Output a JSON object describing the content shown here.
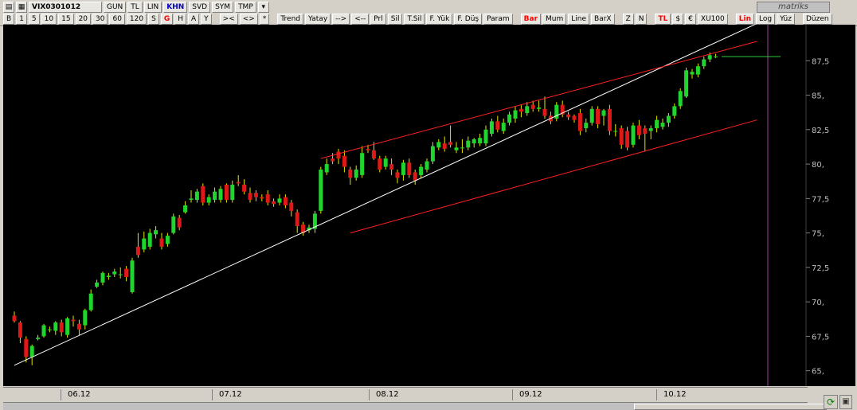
{
  "toolbar": {
    "symbol": "VIX0301012",
    "row1": [
      "GUN",
      "TL",
      "LIN",
      "KHN",
      "SVD",
      "SYM",
      "TMP"
    ],
    "row2_periods": [
      "B",
      "1",
      "5",
      "10",
      "15",
      "20",
      "30",
      "60",
      "120",
      "S",
      "G",
      "H",
      "A",
      "Y"
    ],
    "row2_nav": [
      "><",
      "<>",
      "*"
    ],
    "row2_tools": [
      "Trend",
      "Yatay",
      "-->",
      "<--",
      "Prl",
      "Sil",
      "T.Sil",
      "F. Yük",
      "F. Düş",
      "Param"
    ],
    "row2_types": [
      "Bar",
      "Mum",
      "Line",
      "BarX"
    ],
    "row2_zoom": [
      "Z",
      "N"
    ],
    "row2_units": [
      "TL",
      "$",
      "€",
      "XU100"
    ],
    "row2_scale": [
      "Lin",
      "Log",
      "Yüz"
    ],
    "row2_edit": "Düzen",
    "logo": "matriks"
  },
  "chart_data": {
    "type": "candlestick",
    "ylim": [
      64,
      90
    ],
    "yticks": [
      "65,",
      "67,5",
      "70,",
      "72,5",
      "75,",
      "77,5",
      "80,",
      "82,5",
      "85,",
      "87,5"
    ],
    "xticks": [
      "06.12",
      "07.12",
      "08.12",
      "09.12",
      "10.12"
    ],
    "last_price": 87.8,
    "candles": [
      [
        69.0,
        68.6,
        69.3,
        68.5
      ],
      [
        68.5,
        67.4,
        68.6,
        67.0
      ],
      [
        67.3,
        66.0,
        67.5,
        65.6
      ],
      [
        66.0,
        66.8,
        66.9,
        65.4
      ],
      [
        67.3,
        67.4,
        67.6,
        67.2
      ],
      [
        67.5,
        68.3,
        68.4,
        67.4
      ],
      [
        68.0,
        68.0,
        68.2,
        67.8
      ],
      [
        67.9,
        68.5,
        68.6,
        67.6
      ],
      [
        68.5,
        67.8,
        68.7,
        67.5
      ],
      [
        67.6,
        68.8,
        68.9,
        67.4
      ],
      [
        68.7,
        68.6,
        69.0,
        68.2
      ],
      [
        68.4,
        68.0,
        68.7,
        67.6
      ],
      [
        68.3,
        69.4,
        69.5,
        68.0
      ],
      [
        69.4,
        70.6,
        70.9,
        69.3
      ],
      [
        71.1,
        71.4,
        71.6,
        71.0
      ],
      [
        71.4,
        72.1,
        72.2,
        71.2
      ],
      [
        71.8,
        71.9,
        72.1,
        71.6
      ],
      [
        72.0,
        72.2,
        72.4,
        71.8
      ],
      [
        72.0,
        72.0,
        72.5,
        71.7
      ],
      [
        72.4,
        71.8,
        72.6,
        71.5
      ],
      [
        70.7,
        73.0,
        73.2,
        70.6
      ],
      [
        74.0,
        73.4,
        75.0,
        73.2
      ],
      [
        73.8,
        74.6,
        75.1,
        73.6
      ],
      [
        74.0,
        75.0,
        75.3,
        73.8
      ],
      [
        74.9,
        75.2,
        75.5,
        74.6
      ],
      [
        74.6,
        74.0,
        75.0,
        73.8
      ],
      [
        74.2,
        74.8,
        75.0,
        74.0
      ],
      [
        75.0,
        76.2,
        76.4,
        74.9
      ],
      [
        76.1,
        75.4,
        76.3,
        75.2
      ],
      [
        76.5,
        77.0,
        77.3,
        76.4
      ],
      [
        77.4,
        77.5,
        78.1,
        77.2
      ],
      [
        77.4,
        78.0,
        78.2,
        77.2
      ],
      [
        78.4,
        77.2,
        78.6,
        77.0
      ],
      [
        77.2,
        77.6,
        77.8,
        77.0
      ],
      [
        77.4,
        78.0,
        78.3,
        77.2
      ],
      [
        77.4,
        78.2,
        78.4,
        77.2
      ],
      [
        78.5,
        77.4,
        78.6,
        77.2
      ],
      [
        77.4,
        78.5,
        78.8,
        77.2
      ],
      [
        78.7,
        78.6,
        79.2,
        78.4
      ],
      [
        78.5,
        78.0,
        78.9,
        77.8
      ],
      [
        77.9,
        77.4,
        78.3,
        77.2
      ],
      [
        77.9,
        77.6,
        78.1,
        77.3
      ],
      [
        77.6,
        77.5,
        77.8,
        77.3
      ],
      [
        77.8,
        77.2,
        78.1,
        77.0
      ],
      [
        77.3,
        77.1,
        77.5,
        76.9
      ],
      [
        77.2,
        77.5,
        77.8,
        77.0
      ],
      [
        77.6,
        77.0,
        77.8,
        76.8
      ],
      [
        77.2,
        76.6,
        77.4,
        76.2
      ],
      [
        76.5,
        75.5,
        76.7,
        75.0
      ],
      [
        75.6,
        75.0,
        75.8,
        74.8
      ],
      [
        75.2,
        75.4,
        75.6,
        75.0
      ],
      [
        75.3,
        76.4,
        76.6,
        75.0
      ],
      [
        76.6,
        79.6,
        79.8,
        76.4
      ],
      [
        79.4,
        80.0,
        80.4,
        79.2
      ],
      [
        80.4,
        80.2,
        80.8,
        80.0
      ],
      [
        80.9,
        80.4,
        81.1,
        80.0
      ],
      [
        80.6,
        79.8,
        81.0,
        79.4
      ],
      [
        79.6,
        79.0,
        79.8,
        78.5
      ],
      [
        79.0,
        79.6,
        79.9,
        78.8
      ],
      [
        79.2,
        80.8,
        81.3,
        79.0
      ],
      [
        81.1,
        81.0,
        81.4,
        80.8
      ],
      [
        81.0,
        80.4,
        81.6,
        80.3
      ],
      [
        80.4,
        79.6,
        80.6,
        79.4
      ],
      [
        79.8,
        80.4,
        80.6,
        79.6
      ],
      [
        80.0,
        79.6,
        80.4,
        79.2
      ],
      [
        79.4,
        79.0,
        79.6,
        78.6
      ],
      [
        79.2,
        80.1,
        80.3,
        78.8
      ],
      [
        80.1,
        79.2,
        80.4,
        79.0
      ],
      [
        79.4,
        78.8,
        79.6,
        78.5
      ],
      [
        79.2,
        79.8,
        80.0,
        79.0
      ],
      [
        79.6,
        80.2,
        80.4,
        79.4
      ],
      [
        80.2,
        81.3,
        81.6,
        80.0
      ],
      [
        81.2,
        81.6,
        81.8,
        81.0
      ],
      [
        81.5,
        81.1,
        82.0,
        80.9
      ],
      [
        81.6,
        81.4,
        82.8,
        81.2
      ],
      [
        81.0,
        81.2,
        81.6,
        80.8
      ],
      [
        81.2,
        81.2,
        81.8,
        80.8
      ],
      [
        81.2,
        81.7,
        82.0,
        81.0
      ],
      [
        81.5,
        81.8,
        81.9,
        81.2
      ],
      [
        81.5,
        81.9,
        82.2,
        81.3
      ],
      [
        81.5,
        82.5,
        82.8,
        81.3
      ],
      [
        82.2,
        83.1,
        83.3,
        82.0
      ],
      [
        83.1,
        82.5,
        83.5,
        82.3
      ],
      [
        82.4,
        83.0,
        83.3,
        82.2
      ],
      [
        83.0,
        83.6,
        83.8,
        82.8
      ],
      [
        83.3,
        83.9,
        84.2,
        83.0
      ],
      [
        84.0,
        83.8,
        84.3,
        83.4
      ],
      [
        83.7,
        84.2,
        84.5,
        83.5
      ],
      [
        84.3,
        84.0,
        84.6,
        83.8
      ],
      [
        84.0,
        84.1,
        84.6,
        83.8
      ],
      [
        84.0,
        83.5,
        84.9,
        83.3
      ],
      [
        83.5,
        83.1,
        83.8,
        82.9
      ],
      [
        83.3,
        84.3,
        84.5,
        83.1
      ],
      [
        84.3,
        83.6,
        84.6,
        83.4
      ],
      [
        83.6,
        83.4,
        83.8,
        83.2
      ],
      [
        83.5,
        83.2,
        83.6,
        83.0
      ],
      [
        83.7,
        82.4,
        84.0,
        82.1
      ],
      [
        82.6,
        83.0,
        83.3,
        82.3
      ],
      [
        83.0,
        84.0,
        84.2,
        82.8
      ],
      [
        84.0,
        82.9,
        84.2,
        82.6
      ],
      [
        83.5,
        83.9,
        84.0,
        82.8
      ],
      [
        84.0,
        82.4,
        84.3,
        82.1
      ],
      [
        82.4,
        82.4,
        82.9,
        82.0
      ],
      [
        82.6,
        81.4,
        82.8,
        81.1
      ],
      [
        82.4,
        81.2,
        82.7,
        81.0
      ],
      [
        81.4,
        82.8,
        83.0,
        81.2
      ],
      [
        82.8,
        82.1,
        83.2,
        81.8
      ],
      [
        82.6,
        82.2,
        82.8,
        80.9
      ],
      [
        82.4,
        82.6,
        82.8,
        81.8
      ],
      [
        82.6,
        83.2,
        83.5,
        82.3
      ],
      [
        82.7,
        83.0,
        83.3,
        82.5
      ],
      [
        83.0,
        83.5,
        83.7,
        82.7
      ],
      [
        83.5,
        84.2,
        84.4,
        83.3
      ],
      [
        84.2,
        85.3,
        85.5,
        84.0
      ],
      [
        84.9,
        86.8,
        87.0,
        84.8
      ],
      [
        86.5,
        86.7,
        86.9,
        86.2
      ],
      [
        86.5,
        87.1,
        87.3,
        86.3
      ],
      [
        87.1,
        87.6,
        87.8,
        86.9
      ],
      [
        87.6,
        87.9,
        88.1,
        87.4
      ],
      [
        87.8,
        87.8,
        88.0,
        87.7
      ]
    ],
    "lines": [
      {
        "color": "#ffffff",
        "points": [
          [
            0,
            65.4
          ],
          [
            126,
            90.2
          ]
        ]
      },
      {
        "color": "#ff2020",
        "points": [
          [
            52,
            80.4
          ],
          [
            126,
            88.9
          ]
        ]
      },
      {
        "color": "#ff2020",
        "points": [
          [
            57,
            75.0
          ],
          [
            126,
            83.2
          ]
        ]
      },
      {
        "color": "#2ecc40",
        "points": [
          [
            120,
            87.8
          ],
          [
            130,
            87.8
          ]
        ]
      }
    ]
  }
}
